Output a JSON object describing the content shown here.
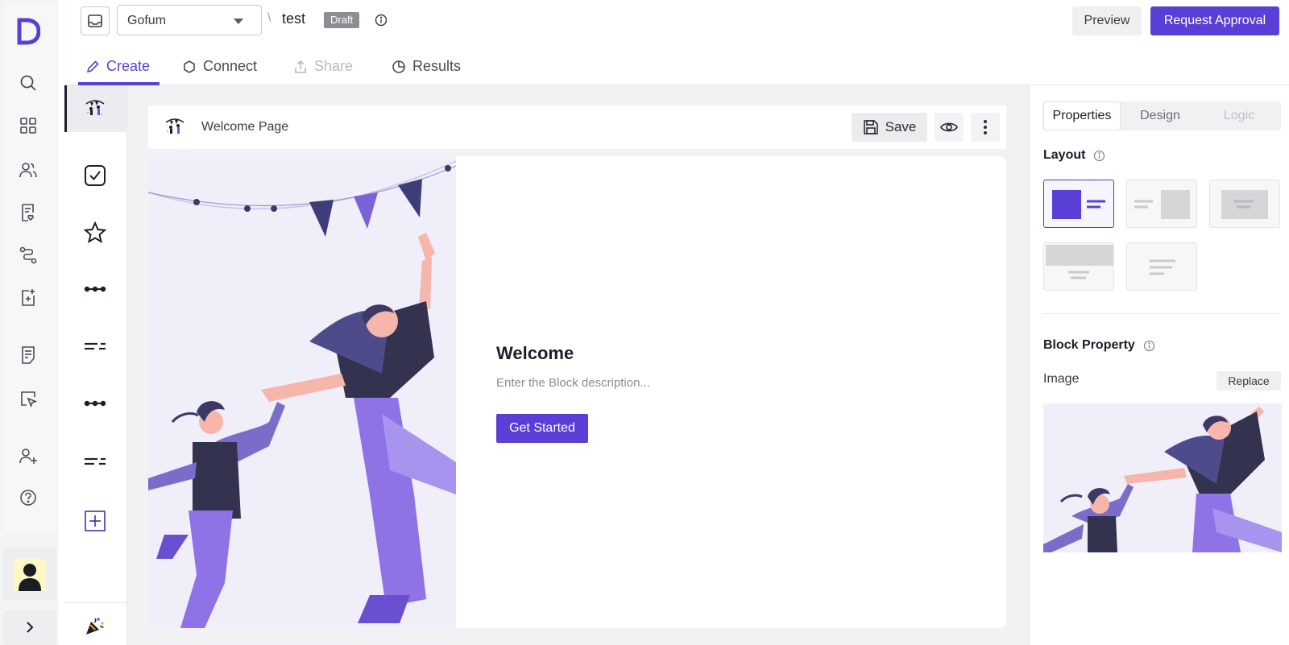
{
  "app": {
    "logo_letter": "D",
    "brand_color": "#5a3fd6"
  },
  "rail": {
    "icons": [
      "search-icon",
      "grid-icon",
      "users-icon",
      "form-heart-icon",
      "route-icon",
      "add-page-icon",
      "document-icon",
      "cursor-select-icon",
      "add-user-icon",
      "help-icon"
    ],
    "avatar": "user-avatar",
    "expand_icon": "chevron-right-icon"
  },
  "header": {
    "workspace": "Gofum",
    "separator": "\\",
    "form_title": "test",
    "status": "Draft",
    "preview_label": "Preview",
    "approval_label": "Request Approval",
    "tabs": [
      {
        "label": "Create",
        "icon": "pencil-icon",
        "state": "active"
      },
      {
        "label": "Connect",
        "icon": "hexagon-icon",
        "state": "normal"
      },
      {
        "label": "Share",
        "icon": "share-icon",
        "state": "disabled"
      },
      {
        "label": "Results",
        "icon": "pie-chart-icon",
        "state": "normal"
      }
    ]
  },
  "blocks": {
    "items": [
      "welcome-block-icon",
      "checkbox-block-icon",
      "star-rating-block-icon",
      "dots-block-icon",
      "lines-block-icon",
      "dots-block-icon",
      "lines-block-icon",
      "add-block-icon"
    ],
    "end_icon": "party-popper-icon"
  },
  "canvas": {
    "page_name": "Welcome Page",
    "save_label": "Save",
    "welcome_title": "Welcome",
    "welcome_description": "Enter the Block description...",
    "cta_label": "Get Started"
  },
  "panel": {
    "tabs": [
      "Properties",
      "Design",
      "Logic"
    ],
    "layout_title": "Layout",
    "block_property_title": "Block Property",
    "image_label": "Image",
    "replace_label": "Replace"
  }
}
